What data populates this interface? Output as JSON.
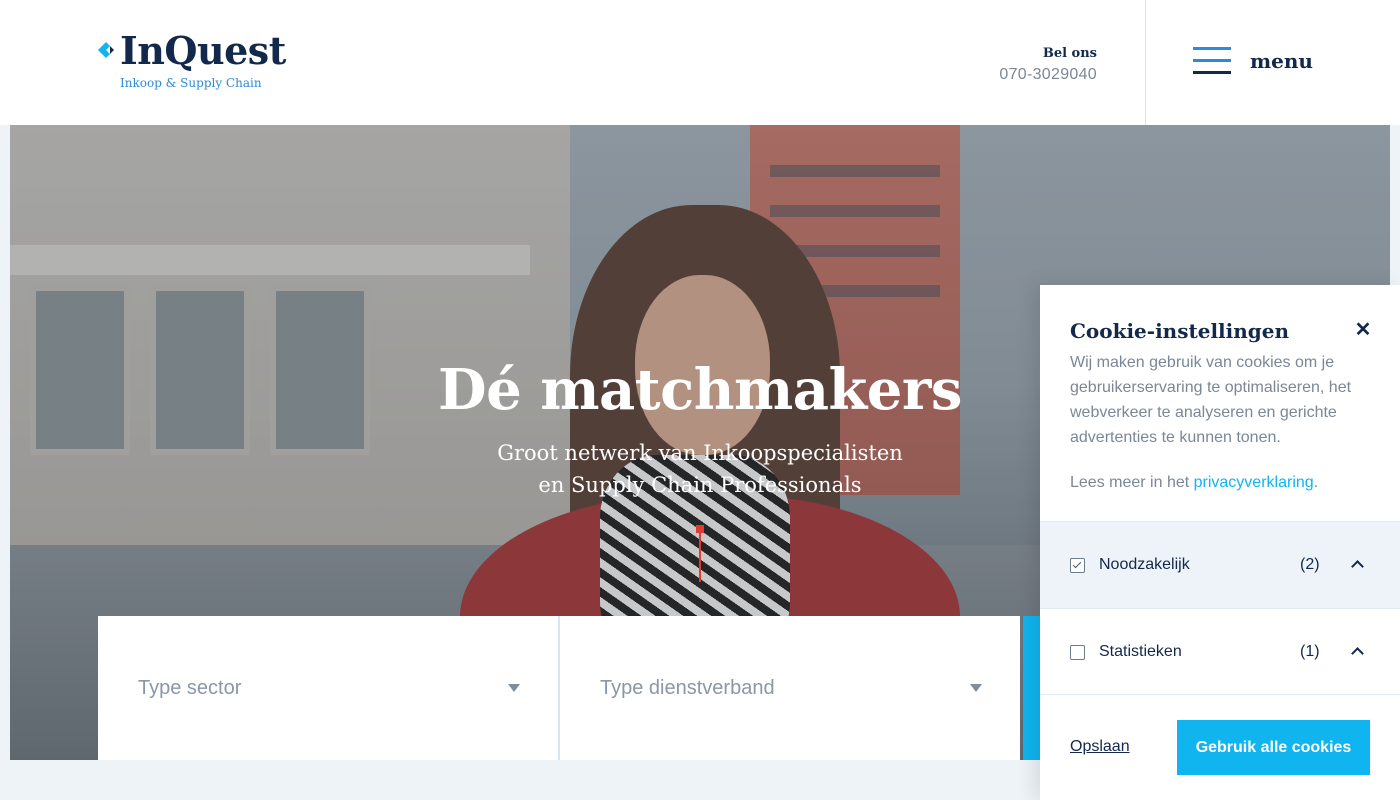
{
  "header": {
    "logo_title": "InQuest",
    "logo_subtitle": "Inkoop & Supply Chain",
    "call_label": "Bel ons",
    "call_number": "070-3029040",
    "menu_label": "menu"
  },
  "hero": {
    "title": "Dé matchmakers",
    "subtitle_line1": "Groot netwerk van Inkoopspecialisten",
    "subtitle_line2": "en Supply Chain Professionals"
  },
  "search": {
    "sector_placeholder": "Type sector",
    "dienstverband_placeholder": "Type dienstverband"
  },
  "cookie": {
    "title": "Cookie-instellingen",
    "close_icon": "close-icon",
    "text": "Wij maken gebruik van cookies om je gebruikerservaring te optimaliseren, het webverkeer te analyseren en gerichte advertenties te kunnen tonen.",
    "more_prefix": "Lees meer in het ",
    "more_link": "privacyverklaring",
    "more_suffix": ".",
    "categories": [
      {
        "label": "Noodzakelijk",
        "count": "(2)",
        "checked": true
      },
      {
        "label": "Statistieken",
        "count": "(1)",
        "checked": false
      }
    ],
    "save_label": "Opslaan",
    "accept_label": "Gebruik alle cookies"
  },
  "colors": {
    "navy": "#13294b",
    "accent_blue": "#10b4ef",
    "logo_blue": "#2a8bd6",
    "scroll_red": "#e33a2f"
  }
}
